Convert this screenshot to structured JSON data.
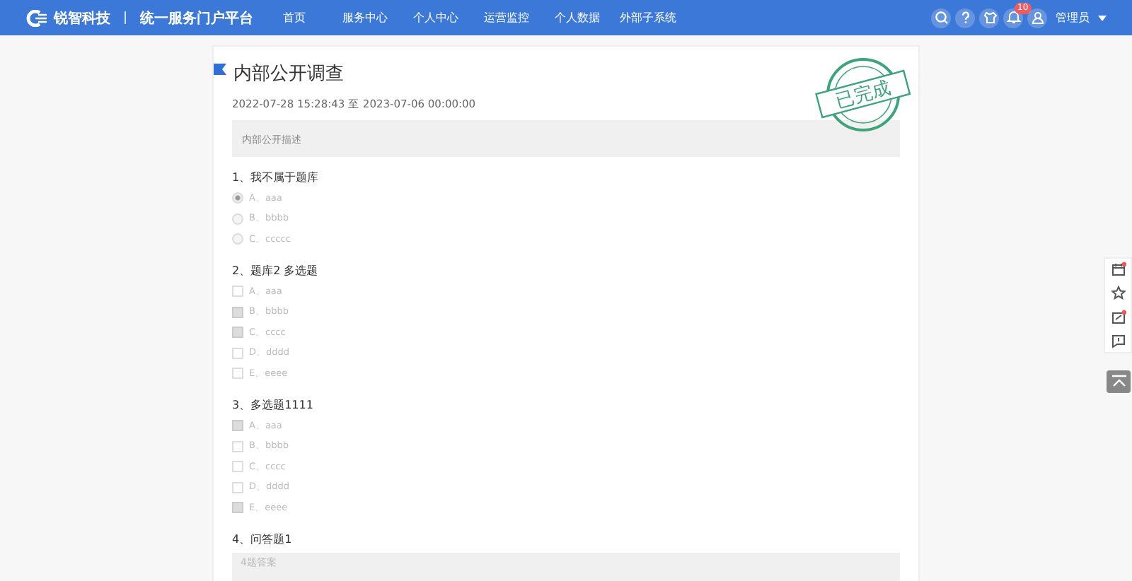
{
  "header": {
    "logo_text": "锐智科技",
    "platform_title": "统一服务门户平台",
    "nav": [
      {
        "label": "首页",
        "selected": false
      },
      {
        "label": "服务中心",
        "selected": false
      },
      {
        "label": "个人中心",
        "selected": false
      },
      {
        "label": "运营监控",
        "selected": false
      },
      {
        "label": "个人数据",
        "selected": false
      },
      {
        "label": "外部子系统",
        "selected": false
      }
    ],
    "notification_count": "10",
    "user": "管理员"
  },
  "survey": {
    "title": "内部公开调查",
    "period": "2022-07-28 15:28:43 至 2023-07-06 00:00:00",
    "description": "内部公开描述",
    "stamp": "已完成",
    "questions": [
      {
        "kind": "radio",
        "title": "1、我不属于题库",
        "options": [
          {
            "label": "A、aaa",
            "selected": true
          },
          {
            "label": "B、bbbb",
            "selected": false
          },
          {
            "label": "C、ccccc",
            "selected": false
          }
        ]
      },
      {
        "kind": "checkbox",
        "title": "2、题库2 多选题",
        "options": [
          {
            "label": "A、aaa",
            "selected": false
          },
          {
            "label": "B、bbbb",
            "selected": true
          },
          {
            "label": "C、cccc",
            "selected": true
          },
          {
            "label": "D、dddd",
            "selected": false
          },
          {
            "label": "E、eeee",
            "selected": false
          }
        ]
      },
      {
        "kind": "checkbox",
        "title": "3、多选题1111",
        "options": [
          {
            "label": "A、aaa",
            "selected": true
          },
          {
            "label": "B、bbbb",
            "selected": false
          },
          {
            "label": "C、cccc",
            "selected": false
          },
          {
            "label": "D、dddd",
            "selected": false
          },
          {
            "label": "E、eeee",
            "selected": true
          }
        ]
      },
      {
        "kind": "text",
        "title": "4、问答题1",
        "placeholder": "4题答案"
      }
    ]
  }
}
